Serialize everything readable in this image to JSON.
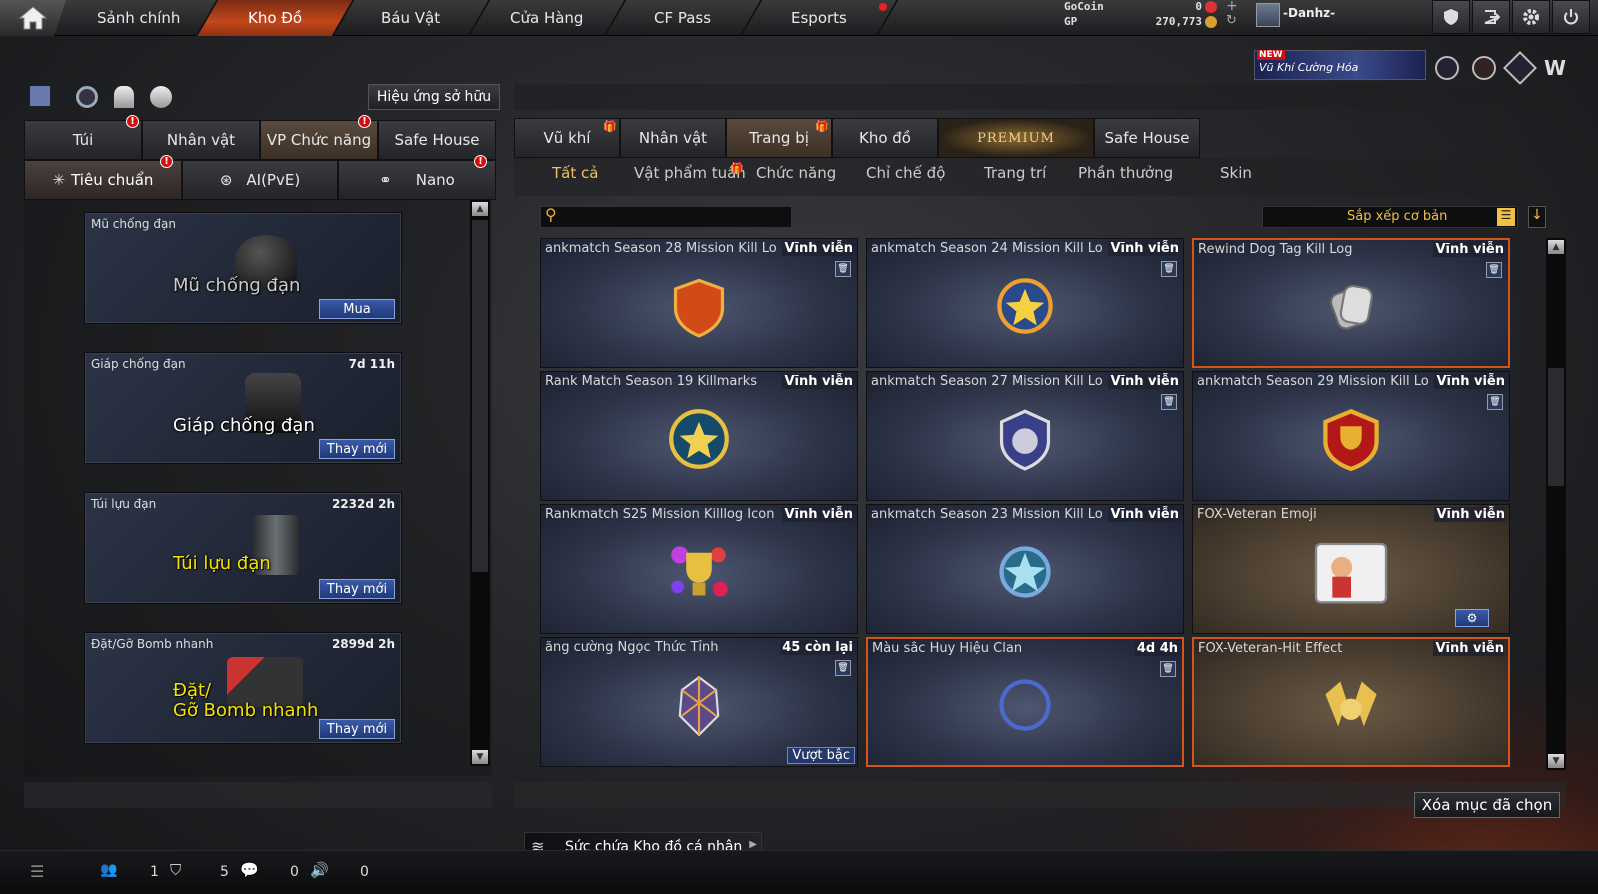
{
  "nav": {
    "items": [
      "Sảnh chính",
      "Kho Đồ",
      "Báu Vật",
      "Cửa Hàng",
      "CF Pass",
      "Esports"
    ],
    "active": "Kho Đồ"
  },
  "currency": {
    "gocoin_label": "GoCoin",
    "gocoin_value": "0",
    "gp_label": "GP",
    "gp_value": "270,773"
  },
  "player": {
    "name": "-Danhz-"
  },
  "banner": {
    "badge": "NEW",
    "text": "Vũ Khí Cường Hóa"
  },
  "left": {
    "effect_button": "Hiệu ứng sở hữu",
    "tabs": [
      "Túi",
      "Nhân vật",
      "VP Chức năng",
      "Safe House"
    ],
    "subtabs": [
      "Tiêu chuẩn",
      "AI(PvE)",
      "Nano"
    ],
    "slots": [
      {
        "name": "Mũ chống đạn",
        "time": "",
        "big": "Mũ chống đạn",
        "button": "Mua"
      },
      {
        "name": "Giáp chống đạn",
        "time": "7d 11h",
        "big": "Giáp chống đạn",
        "button": "Thay mới"
      },
      {
        "name": "Túi lựu đạn",
        "time": "2232d 2h",
        "big": "Túi lựu đạn",
        "button": "Thay mới"
      },
      {
        "name": "Đặt/Gỡ Bomb nhanh",
        "time": "2899d 2h",
        "big": "Đặt/\nGỡ Bomb nhanh",
        "button": "Thay mới"
      }
    ]
  },
  "right": {
    "tabs": [
      "Vũ khí",
      "Nhân vật",
      "Trang bị",
      "Kho đồ",
      "PREMIUM",
      "Safe House"
    ],
    "subtabs": [
      "Tất cả",
      "Vật phẩm tuần",
      "Chức năng",
      "Chỉ chế độ",
      "Trang trí",
      "Phần thưởng",
      "Skin"
    ],
    "sort_label": "Sắp xếp cơ bản",
    "search_placeholder": "",
    "items": [
      {
        "name": "ankmatch Season 28 Mission Kill Lo",
        "right": "Vĩnh viễn",
        "icon": "shield-emblem-icon"
      },
      {
        "name": "ankmatch Season 24 Mission Kill Lo",
        "right": "Vĩnh viễn",
        "icon": "star-flame-emblem-icon"
      },
      {
        "name": "Rewind Dog Tag Kill Log",
        "right": "Vĩnh viễn",
        "icon": "dog-tag-icon"
      },
      {
        "name": "Rank Match Season 19 Killmarks",
        "right": "Vĩnh viễn",
        "icon": "trophy-emblem-icon"
      },
      {
        "name": "ankmatch Season 27 Mission Kill Lo",
        "right": "Vĩnh viễn",
        "icon": "wolf-emblem-icon"
      },
      {
        "name": "ankmatch Season 29 Mission Kill Lo",
        "right": "Vĩnh viễn",
        "icon": "red-trophy-emblem-icon"
      },
      {
        "name": "Rankmatch S25 Mission Killlog Icon",
        "right": "Vĩnh viễn",
        "icon": "cup-fireworks-icon"
      },
      {
        "name": "ankmatch Season 23 Mission Kill Lo",
        "right": "Vĩnh viễn",
        "icon": "star-wings-emblem-icon"
      },
      {
        "name": "FOX-Veteran Emoji",
        "right": "Vĩnh viễn",
        "icon": "emoji-sticker-icon"
      },
      {
        "name": "ăng cường Ngọc Thức Tỉnh",
        "right": "45 còn lại",
        "icon": "gem-icon",
        "extra": "Vượt bậc"
      },
      {
        "name": "Màu sắc Huy Hiệu Clan",
        "right": "4d 4h",
        "icon": "ring-icon"
      },
      {
        "name": "FOX-Veteran-Hit Effect",
        "right": "Vĩnh viễn",
        "icon": "fox-hit-effect-icon"
      }
    ],
    "delete_button": "Xóa mục đã chọn",
    "capacity_label": "Sức chứa Kho đồ cá nhân"
  },
  "bottom": {
    "stats": [
      "1",
      "5",
      "0",
      "0"
    ]
  }
}
